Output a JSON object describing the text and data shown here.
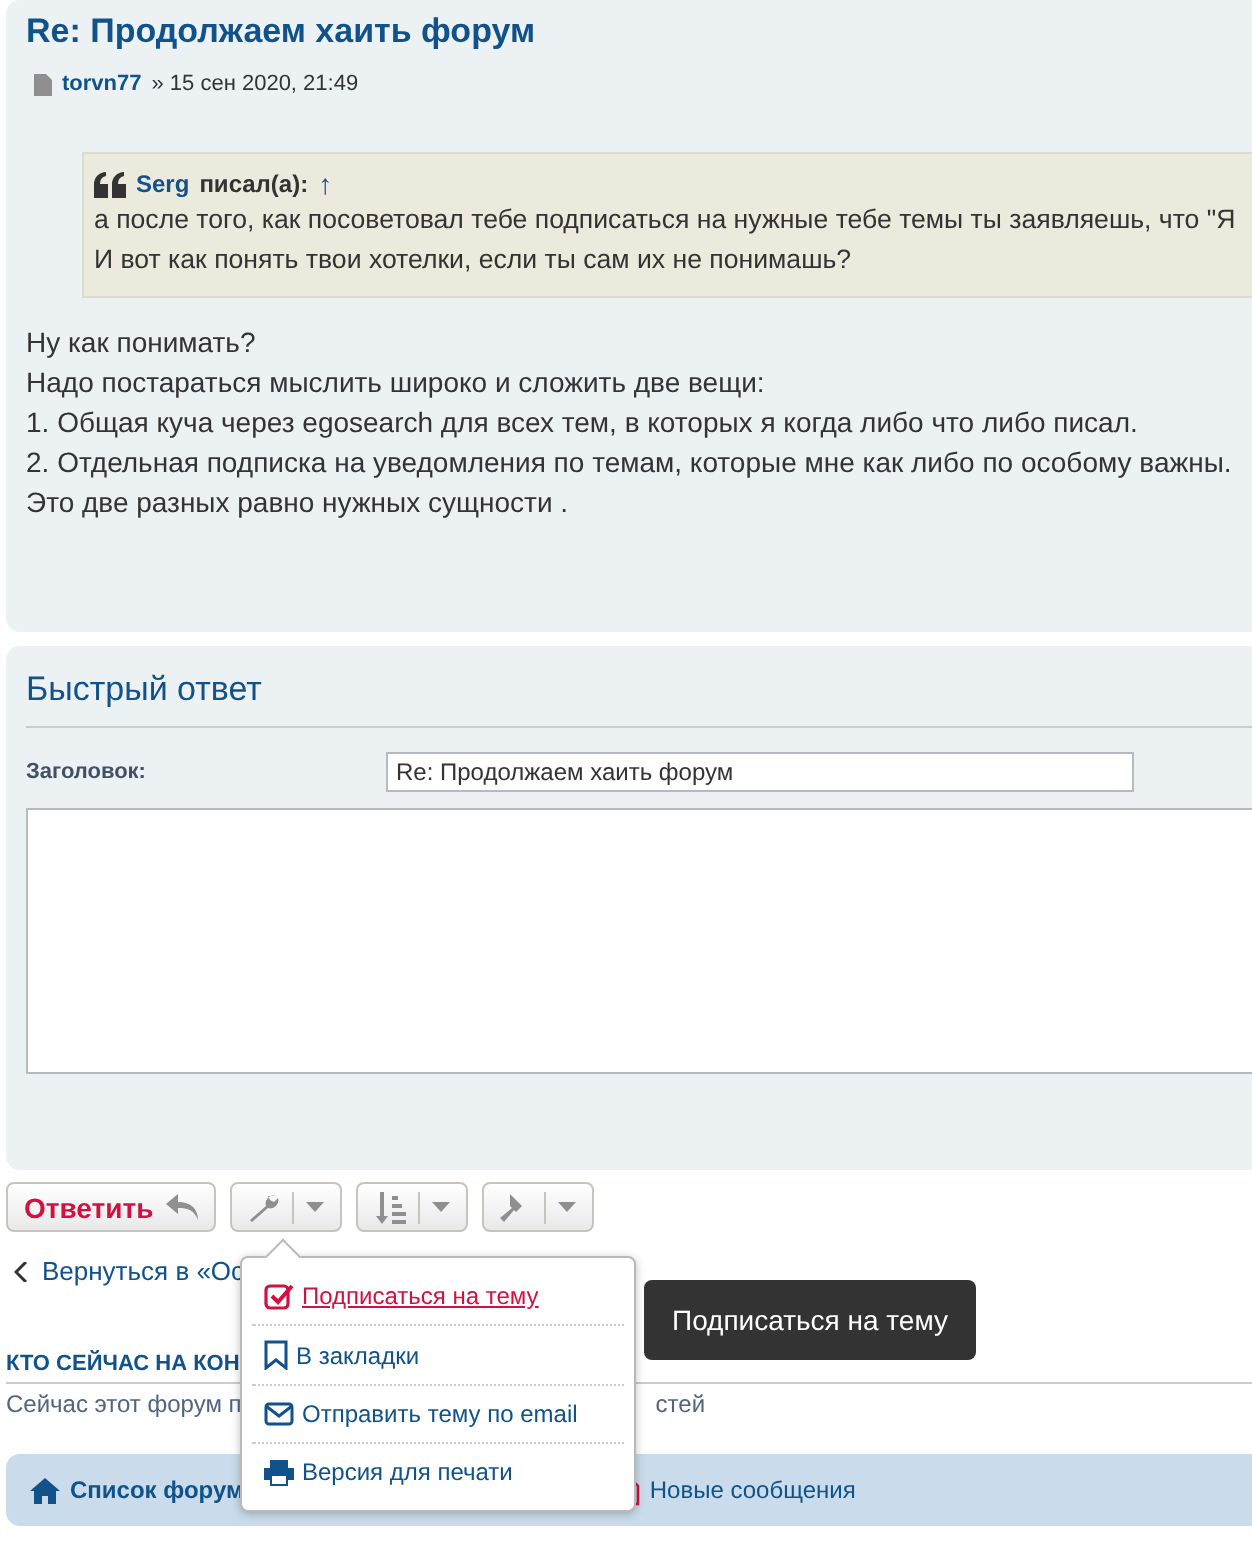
{
  "post": {
    "title": "Re: Продолжаем хаить форум",
    "author": "torvn77",
    "date": "» 15 сен 2020, 21:49",
    "quote": {
      "author": "Serg",
      "wrote": "писал(а):",
      "arrow": "↑",
      "lines": [
        "а после того, как посоветовал тебе подписаться на нужные тебе темы ты заявляешь, что \"Я",
        "И вот как понять твои хотелки, если ты сам их не понимашь?"
      ]
    },
    "lines": [
      "Ну как понимать?",
      "Надо постараться мыслить широко и сложить две вещи:",
      "1. Общая куча через egosearch для всех тем, в которых я когда либо что либо писал.",
      "2. Отдельная подписка на уведомления по темам, которые мне как либо по особому важны.",
      "Это две разных равно нужных сущности ."
    ]
  },
  "quick_reply": {
    "title": "Быстрый ответ",
    "subject_label": "Заголовок:",
    "subject_value": "Re: Продолжаем хаить форум"
  },
  "reply_button": "Ответить",
  "back_link": "Вернуться в «Ос",
  "who_online": {
    "title": "КТО СЕЙЧАС НА КОН",
    "text": "Сейчас этот форум п",
    "text_tail": "стей"
  },
  "menu": [
    {
      "kind": "subscribe",
      "label": "Подписаться на тему",
      "highlighted": true
    },
    {
      "kind": "bookmark",
      "label": "В закладки",
      "highlighted": false
    },
    {
      "kind": "email",
      "label": "Отправить тему по email",
      "highlighted": false
    },
    {
      "kind": "print",
      "label": "Версия для печати",
      "highlighted": false
    }
  ],
  "tooltip": "Подписаться на тему",
  "footer": [
    {
      "kind": "home",
      "label": "Список форум"
    },
    {
      "kind": "new",
      "label": "Новые сообщения"
    }
  ]
}
